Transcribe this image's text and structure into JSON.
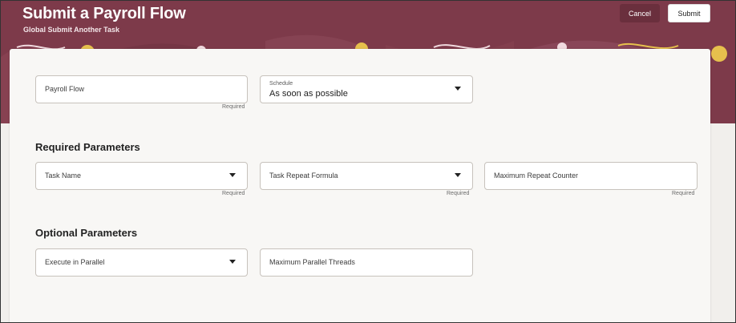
{
  "header": {
    "title": "Submit a Payroll Flow",
    "subtitle": "Global Submit Another Task",
    "cancel_label": "Cancel",
    "submit_label": "Submit",
    "background_color": "#7d3a4a",
    "accent_color": "#e6c04d"
  },
  "top_fields": {
    "payroll_flow": {
      "label": "Payroll Flow",
      "hint": "Required"
    },
    "schedule": {
      "label": "Schedule",
      "value": "As soon as possible"
    }
  },
  "required_section": {
    "heading": "Required Parameters",
    "task_name": {
      "label": "Task Name",
      "hint": "Required"
    },
    "task_repeat_formula": {
      "label": "Task Repeat Formula",
      "hint": "Required"
    },
    "maximum_repeat_counter": {
      "label": "Maximum Repeat Counter",
      "hint": "Required"
    }
  },
  "optional_section": {
    "heading": "Optional Parameters",
    "execute_in_parallel": {
      "label": "Execute in Parallel"
    },
    "maximum_parallel_threads": {
      "label": "Maximum Parallel Threads"
    }
  }
}
